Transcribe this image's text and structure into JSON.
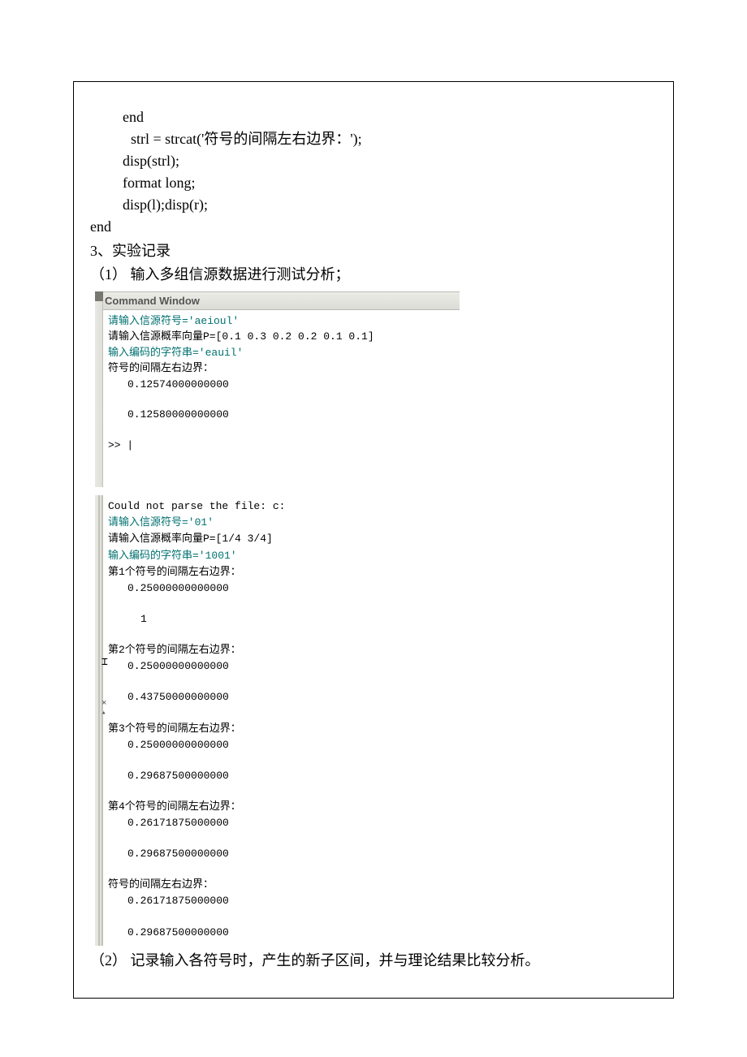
{
  "code": {
    "l1": "end",
    "l2": "strl = strcat('符号的间隔左右边界：');",
    "l3": "disp(strl);",
    "l4": "format long;",
    "l5": "disp(l);disp(r);",
    "l6": "end"
  },
  "heading": "3、实验记录",
  "sub1": "（1） 输入多组信源数据进行测试分析；",
  "cmd_title": "Command Window",
  "block1": {
    "p1": "请输入信源符号='aeioul'",
    "p2": "请输入信源概率向量P=[0.1 0.3 0.2 0.2 0.1 0.1]",
    "p3": "输入编码的字符串='eauil'",
    "p4": "符号的间隔左右边界：",
    "v1": "0.12574000000000",
    "v2": "0.12580000000000",
    "prompt": ">> |"
  },
  "block2": {
    "p0": "Could not parse the file: c:",
    "p1": "请输入信源符号='01'",
    "p2": "请输入信源概率向量P=[1/4 3/4]",
    "p3": "输入编码的字符串='1001'",
    "s1": "第1个符号的间隔左右边界：",
    "s1v1": "0.25000000000000",
    "s1v2": "1",
    "s2": "第2个符号的间隔左右边界：",
    "s2v1": "0.25000000000000",
    "s2v2": "0.43750000000000",
    "s3": "第3个符号的间隔左右边界：",
    "s3v1": "0.25000000000000",
    "s3v2": "0.29687500000000",
    "s4": "第4个符号的间隔左右边界：",
    "s4v1": "0.26171875000000",
    "s4v2": "0.29687500000000",
    "sf": "符号的间隔左右边界：",
    "sfv1": "0.26171875000000",
    "sfv2": "0.29687500000000"
  },
  "sub2": "（2） 记录输入各符号时，产生的新子区间，并与理论结果比较分析。"
}
